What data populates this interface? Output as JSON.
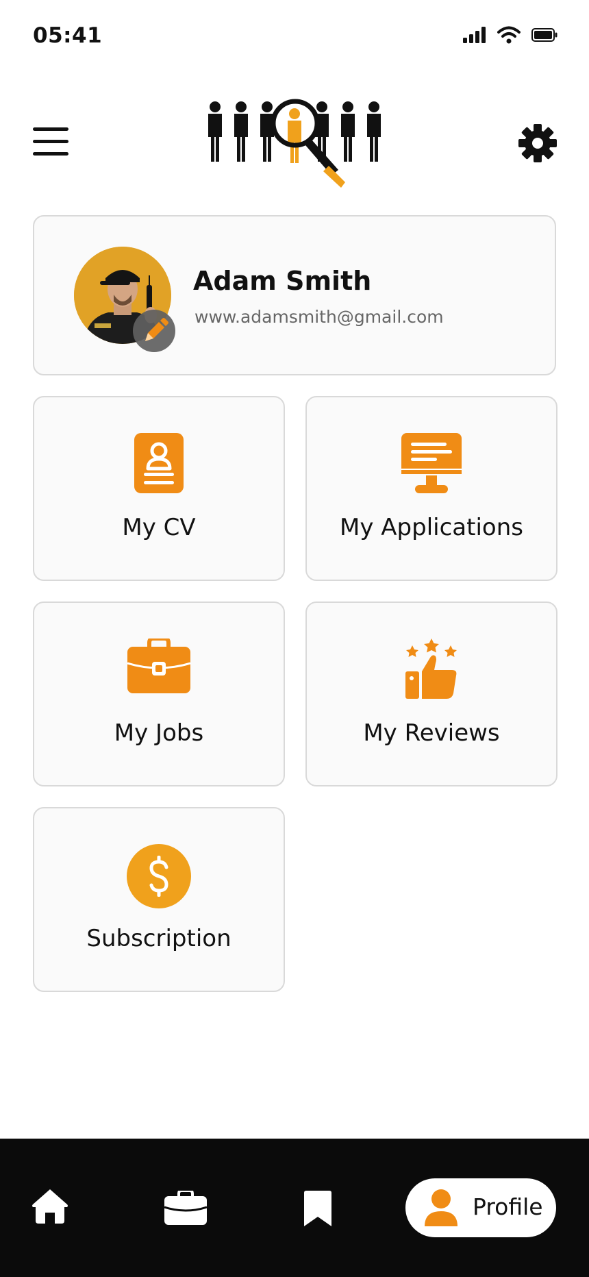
{
  "status_bar": {
    "time": "05:41"
  },
  "profile": {
    "name": "Adam Smith",
    "email": "www.adamsmith@gmail.com"
  },
  "tiles": [
    {
      "label": "My CV",
      "icon": "cv-icon"
    },
    {
      "label": "My Applications",
      "icon": "monitor-icon"
    },
    {
      "label": "My Jobs",
      "icon": "briefcase-icon"
    },
    {
      "label": "My Reviews",
      "icon": "thumbs-up-stars-icon"
    },
    {
      "label": "Subscription",
      "icon": "dollar-icon"
    }
  ],
  "bottom_nav": {
    "items": [
      {
        "icon": "home-icon"
      },
      {
        "icon": "briefcase-icon"
      },
      {
        "icon": "bookmark-icon"
      },
      {
        "icon": "profile-icon",
        "label": "Profile",
        "active": true
      }
    ]
  },
  "colors": {
    "accent": "#f08c15",
    "accent_gold": "#f0a11c",
    "nav_bg": "#0b0b0b",
    "card_bg": "#fafafa",
    "card_border": "#d9d9d9"
  }
}
